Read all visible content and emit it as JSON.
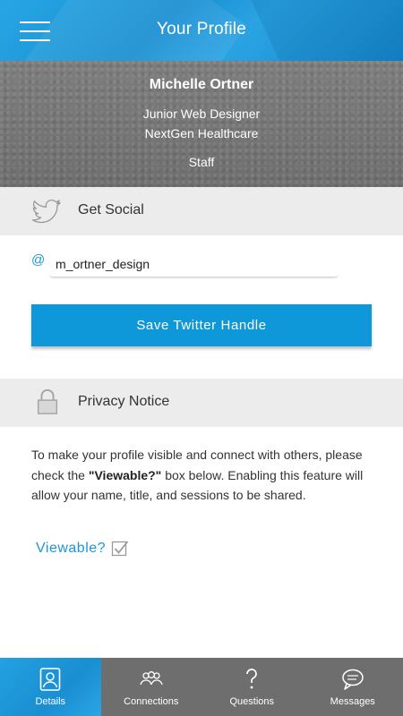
{
  "header": {
    "title": "Your Profile",
    "menu_icon": "hamburger-menu-icon"
  },
  "profile": {
    "name": "Michelle Ortner",
    "role": "Junior Web Designer",
    "organization": "NextGen Healthcare",
    "type": "Staff"
  },
  "social": {
    "section_label": "Get Social",
    "icon": "twitter-bird-icon",
    "at_symbol": "@",
    "handle_value": "m_ortner_design",
    "save_button_label": "Save Twitter Handle"
  },
  "privacy": {
    "section_label": "Privacy Notice",
    "icon": "padlock-icon",
    "text_before": "To make your profile visible and connect with others, please check the ",
    "text_bold": "\"Viewable?\"",
    "text_after": " box below. Enabling this feature will allow your name, title, and sessions to be shared.",
    "viewable_label": "Viewable?",
    "viewable_checked": true
  },
  "tabs": [
    {
      "label": "Details",
      "icon": "person-icon",
      "active": true
    },
    {
      "label": "Connections",
      "icon": "group-icon",
      "active": false
    },
    {
      "label": "Questions",
      "icon": "question-mark-icon",
      "active": false
    },
    {
      "label": "Messages",
      "icon": "speech-bubble-icon",
      "active": false
    }
  ],
  "colors": {
    "accent": "#1a96d8",
    "button": "#0f98d9",
    "tab_inactive": "#6e6e6e",
    "section_bg": "#ececec"
  }
}
